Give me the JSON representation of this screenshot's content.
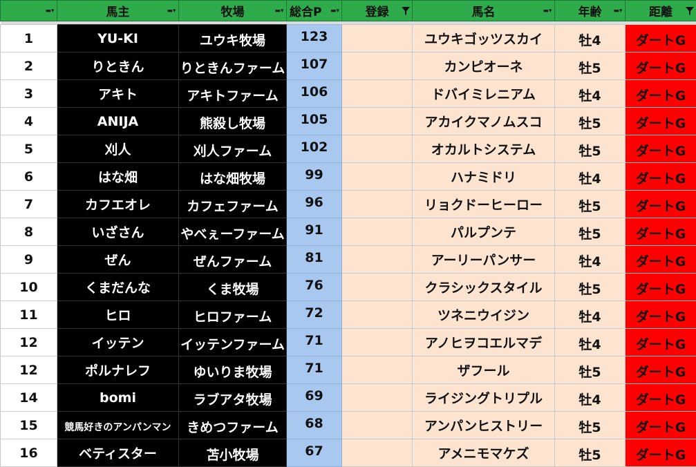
{
  "colors": {
    "header_bg": "#2eab4b",
    "owner_bg": "#000000",
    "points_bg": "#a8c8f0",
    "horse_bg": "#fce4d0",
    "distance_bg": "#ff0000"
  },
  "header": {
    "owner": "馬主",
    "farm": "牧場",
    "points": "総合P",
    "registration": "登録",
    "horse": "馬名",
    "age": "年齢",
    "distance": "距離"
  },
  "rows": [
    {
      "rank": "1",
      "owner": "YU-KI",
      "farm": "ユウキ牧場",
      "points": "123",
      "horse": "ユウキゴッツスカイ",
      "age": "牡4",
      "distance": "ダートG"
    },
    {
      "rank": "2",
      "owner": "りときん",
      "farm": "りときんファーム",
      "points": "107",
      "horse": "カンピオーネ",
      "age": "牡5",
      "distance": "ダートG"
    },
    {
      "rank": "3",
      "owner": "アキト",
      "farm": "アキトファーム",
      "points": "106",
      "horse": "ドバイミレニアム",
      "age": "牡4",
      "distance": "ダートG"
    },
    {
      "rank": "4",
      "owner": "ANIJA",
      "farm": "熊殺し牧場",
      "points": "105",
      "horse": "アカイクマノムスコ",
      "age": "牡5",
      "distance": "ダートG"
    },
    {
      "rank": "5",
      "owner": "刈人",
      "farm": "刈人ファーム",
      "points": "102",
      "horse": "オカルトシステム",
      "age": "牡5",
      "distance": "ダートG"
    },
    {
      "rank": "6",
      "owner": "はな畑",
      "farm": "はな畑牧場",
      "points": "99",
      "horse": "ハナミドリ",
      "age": "牡4",
      "distance": "ダートG"
    },
    {
      "rank": "7",
      "owner": "カフエオレ",
      "farm": "カフェファーム",
      "points": "96",
      "horse": "リョクドーヒーロー",
      "age": "牡5",
      "distance": "ダートG"
    },
    {
      "rank": "8",
      "owner": "いざさん",
      "farm": "やべぇーファーム",
      "points": "91",
      "horse": "パルプンテ",
      "age": "牡5",
      "distance": "ダートG"
    },
    {
      "rank": "9",
      "owner": "ぜん",
      "farm": "ぜんファーム",
      "points": "81",
      "horse": "アーリーパンサー",
      "age": "牡4",
      "distance": "ダートG"
    },
    {
      "rank": "10",
      "owner": "くまだんな",
      "farm": "くま牧場",
      "points": "76",
      "horse": "クラシックスタイル",
      "age": "牡5",
      "distance": "ダートG"
    },
    {
      "rank": "11",
      "owner": "ヒロ",
      "farm": "ヒロファーム",
      "points": "72",
      "horse": "ツネニウイジン",
      "age": "牡4",
      "distance": "ダートG"
    },
    {
      "rank": "12",
      "owner": "イッテン",
      "farm": "イッテンファーム",
      "points": "71",
      "horse": "アノヒヲコエルマデ",
      "age": "牡4",
      "distance": "ダートG"
    },
    {
      "rank": "12",
      "owner": "ポルナレフ",
      "farm": "ゆいりま牧場",
      "points": "71",
      "horse": "ザフール",
      "age": "牡5",
      "distance": "ダートG"
    },
    {
      "rank": "14",
      "owner": "bomi",
      "farm": "ラブアタ牧場",
      "points": "69",
      "horse": "ライジングトリプル",
      "age": "牡4",
      "distance": "ダートG"
    },
    {
      "rank": "15",
      "owner": "競馬好きのアンパンマン",
      "farm": "きめつファーム",
      "points": "68",
      "horse": "アンパンヒストリー",
      "age": "牡5",
      "distance": "ダートG"
    },
    {
      "rank": "16",
      "owner": "ベティスター",
      "farm": "苫小牧場",
      "points": "67",
      "horse": "アメニモマケズ",
      "age": "牡5",
      "distance": "ダートG"
    }
  ]
}
